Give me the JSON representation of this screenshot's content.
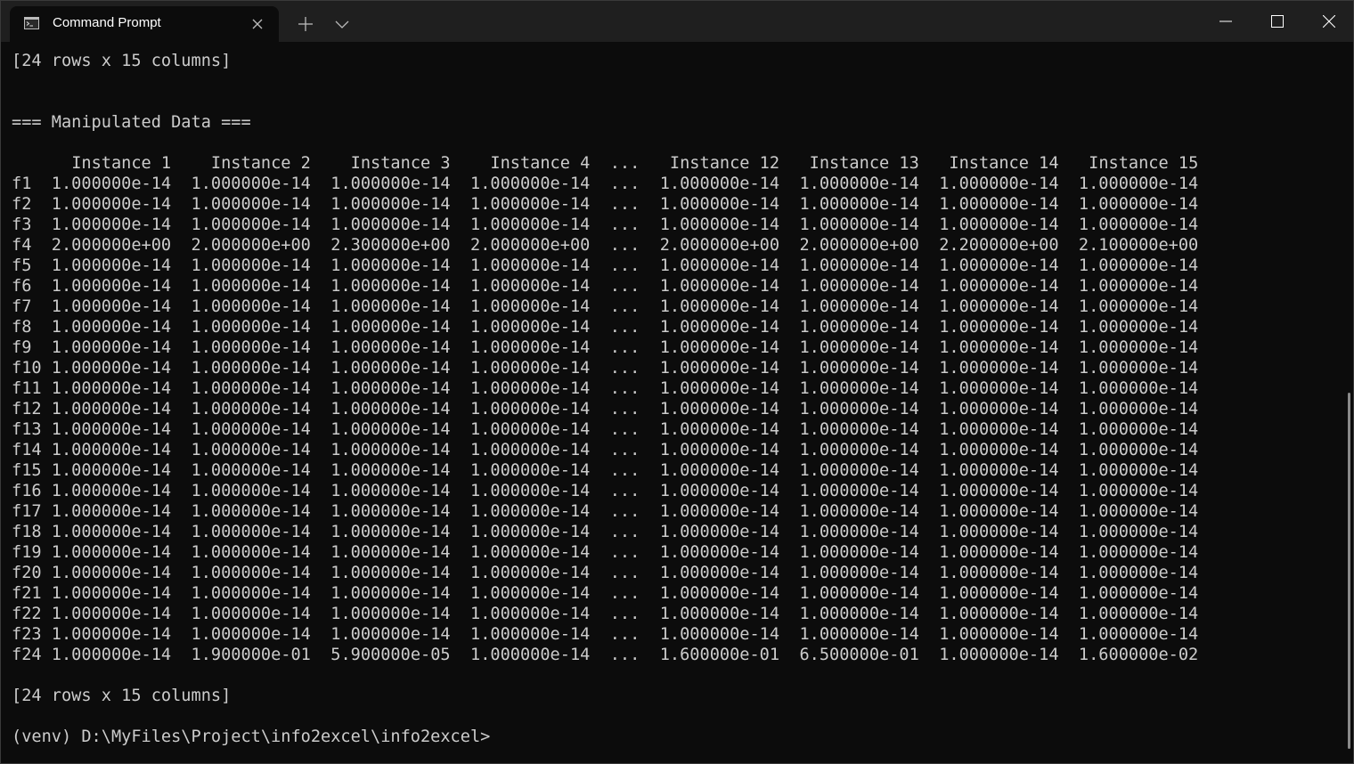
{
  "tab": {
    "title": "Command Prompt",
    "icon": "cmd-icon"
  },
  "icons": {
    "close_tab": "close-icon",
    "new_tab": "plus-icon",
    "dropdown": "chevron-down-icon",
    "minimize": "minimize-icon",
    "maximize": "maximize-icon",
    "close_window": "close-icon"
  },
  "console": {
    "header_summary": "[24 rows x 15 columns]",
    "section_title": "=== Manipulated Data ===",
    "columns": [
      "Instance 1",
      "Instance 2",
      "Instance 3",
      "Instance 4",
      "...",
      "Instance 12",
      "Instance 13",
      "Instance 14",
      "Instance 15"
    ],
    "rows": [
      {
        "label": "f1",
        "values": [
          "1.000000e-14",
          "1.000000e-14",
          "1.000000e-14",
          "1.000000e-14",
          "...",
          "1.000000e-14",
          "1.000000e-14",
          "1.000000e-14",
          "1.000000e-14"
        ]
      },
      {
        "label": "f2",
        "values": [
          "1.000000e-14",
          "1.000000e-14",
          "1.000000e-14",
          "1.000000e-14",
          "...",
          "1.000000e-14",
          "1.000000e-14",
          "1.000000e-14",
          "1.000000e-14"
        ]
      },
      {
        "label": "f3",
        "values": [
          "1.000000e-14",
          "1.000000e-14",
          "1.000000e-14",
          "1.000000e-14",
          "...",
          "1.000000e-14",
          "1.000000e-14",
          "1.000000e-14",
          "1.000000e-14"
        ]
      },
      {
        "label": "f4",
        "values": [
          "2.000000e+00",
          "2.000000e+00",
          "2.300000e+00",
          "2.000000e+00",
          "...",
          "2.000000e+00",
          "2.000000e+00",
          "2.200000e+00",
          "2.100000e+00"
        ]
      },
      {
        "label": "f5",
        "values": [
          "1.000000e-14",
          "1.000000e-14",
          "1.000000e-14",
          "1.000000e-14",
          "...",
          "1.000000e-14",
          "1.000000e-14",
          "1.000000e-14",
          "1.000000e-14"
        ]
      },
      {
        "label": "f6",
        "values": [
          "1.000000e-14",
          "1.000000e-14",
          "1.000000e-14",
          "1.000000e-14",
          "...",
          "1.000000e-14",
          "1.000000e-14",
          "1.000000e-14",
          "1.000000e-14"
        ]
      },
      {
        "label": "f7",
        "values": [
          "1.000000e-14",
          "1.000000e-14",
          "1.000000e-14",
          "1.000000e-14",
          "...",
          "1.000000e-14",
          "1.000000e-14",
          "1.000000e-14",
          "1.000000e-14"
        ]
      },
      {
        "label": "f8",
        "values": [
          "1.000000e-14",
          "1.000000e-14",
          "1.000000e-14",
          "1.000000e-14",
          "...",
          "1.000000e-14",
          "1.000000e-14",
          "1.000000e-14",
          "1.000000e-14"
        ]
      },
      {
        "label": "f9",
        "values": [
          "1.000000e-14",
          "1.000000e-14",
          "1.000000e-14",
          "1.000000e-14",
          "...",
          "1.000000e-14",
          "1.000000e-14",
          "1.000000e-14",
          "1.000000e-14"
        ]
      },
      {
        "label": "f10",
        "values": [
          "1.000000e-14",
          "1.000000e-14",
          "1.000000e-14",
          "1.000000e-14",
          "...",
          "1.000000e-14",
          "1.000000e-14",
          "1.000000e-14",
          "1.000000e-14"
        ]
      },
      {
        "label": "f11",
        "values": [
          "1.000000e-14",
          "1.000000e-14",
          "1.000000e-14",
          "1.000000e-14",
          "...",
          "1.000000e-14",
          "1.000000e-14",
          "1.000000e-14",
          "1.000000e-14"
        ]
      },
      {
        "label": "f12",
        "values": [
          "1.000000e-14",
          "1.000000e-14",
          "1.000000e-14",
          "1.000000e-14",
          "...",
          "1.000000e-14",
          "1.000000e-14",
          "1.000000e-14",
          "1.000000e-14"
        ]
      },
      {
        "label": "f13",
        "values": [
          "1.000000e-14",
          "1.000000e-14",
          "1.000000e-14",
          "1.000000e-14",
          "...",
          "1.000000e-14",
          "1.000000e-14",
          "1.000000e-14",
          "1.000000e-14"
        ]
      },
      {
        "label": "f14",
        "values": [
          "1.000000e-14",
          "1.000000e-14",
          "1.000000e-14",
          "1.000000e-14",
          "...",
          "1.000000e-14",
          "1.000000e-14",
          "1.000000e-14",
          "1.000000e-14"
        ]
      },
      {
        "label": "f15",
        "values": [
          "1.000000e-14",
          "1.000000e-14",
          "1.000000e-14",
          "1.000000e-14",
          "...",
          "1.000000e-14",
          "1.000000e-14",
          "1.000000e-14",
          "1.000000e-14"
        ]
      },
      {
        "label": "f16",
        "values": [
          "1.000000e-14",
          "1.000000e-14",
          "1.000000e-14",
          "1.000000e-14",
          "...",
          "1.000000e-14",
          "1.000000e-14",
          "1.000000e-14",
          "1.000000e-14"
        ]
      },
      {
        "label": "f17",
        "values": [
          "1.000000e-14",
          "1.000000e-14",
          "1.000000e-14",
          "1.000000e-14",
          "...",
          "1.000000e-14",
          "1.000000e-14",
          "1.000000e-14",
          "1.000000e-14"
        ]
      },
      {
        "label": "f18",
        "values": [
          "1.000000e-14",
          "1.000000e-14",
          "1.000000e-14",
          "1.000000e-14",
          "...",
          "1.000000e-14",
          "1.000000e-14",
          "1.000000e-14",
          "1.000000e-14"
        ]
      },
      {
        "label": "f19",
        "values": [
          "1.000000e-14",
          "1.000000e-14",
          "1.000000e-14",
          "1.000000e-14",
          "...",
          "1.000000e-14",
          "1.000000e-14",
          "1.000000e-14",
          "1.000000e-14"
        ]
      },
      {
        "label": "f20",
        "values": [
          "1.000000e-14",
          "1.000000e-14",
          "1.000000e-14",
          "1.000000e-14",
          "...",
          "1.000000e-14",
          "1.000000e-14",
          "1.000000e-14",
          "1.000000e-14"
        ]
      },
      {
        "label": "f21",
        "values": [
          "1.000000e-14",
          "1.000000e-14",
          "1.000000e-14",
          "1.000000e-14",
          "...",
          "1.000000e-14",
          "1.000000e-14",
          "1.000000e-14",
          "1.000000e-14"
        ]
      },
      {
        "label": "f22",
        "values": [
          "1.000000e-14",
          "1.000000e-14",
          "1.000000e-14",
          "1.000000e-14",
          "...",
          "1.000000e-14",
          "1.000000e-14",
          "1.000000e-14",
          "1.000000e-14"
        ]
      },
      {
        "label": "f23",
        "values": [
          "1.000000e-14",
          "1.000000e-14",
          "1.000000e-14",
          "1.000000e-14",
          "...",
          "1.000000e-14",
          "1.000000e-14",
          "1.000000e-14",
          "1.000000e-14"
        ]
      },
      {
        "label": "f24",
        "values": [
          "1.000000e-14",
          "1.900000e-01",
          "5.900000e-05",
          "1.000000e-14",
          "...",
          "1.600000e-01",
          "6.500000e-01",
          "1.000000e-14",
          "1.600000e-02"
        ]
      }
    ],
    "footer_summary": "[24 rows x 15 columns]",
    "prompt": "(venv) D:\\MyFiles\\Project\\info2excel\\info2excel>"
  },
  "colors": {
    "background": "#0c0c0c",
    "titlebar": "#1f1f1f",
    "text": "#cccccc"
  }
}
